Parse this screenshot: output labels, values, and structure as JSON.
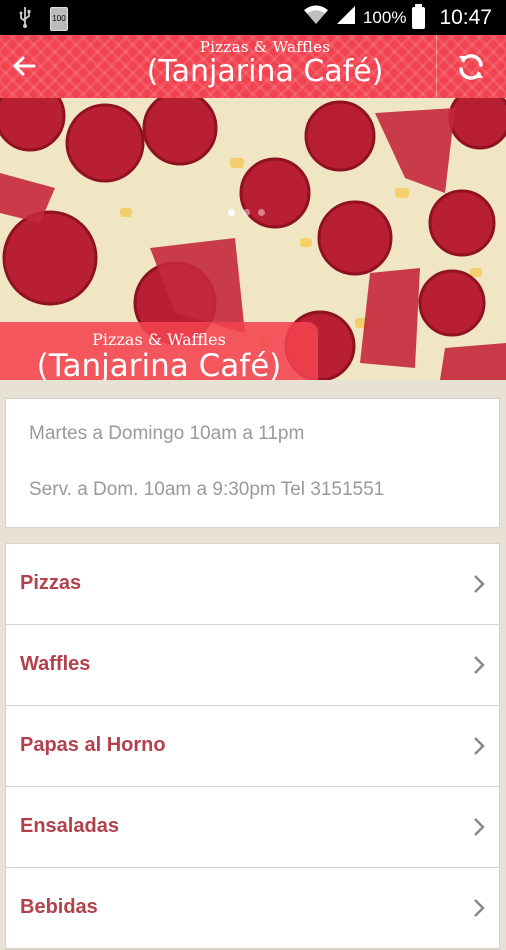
{
  "status_bar": {
    "battery_icon_label": "100",
    "battery_percent": "100%",
    "time": "10:47"
  },
  "header": {
    "subtitle": "Pizzas & Waffles",
    "title": "(Tanjarina Café)"
  },
  "hero": {
    "banner_subtitle": "Pizzas & Waffles",
    "banner_title": "(Tanjarina Café)",
    "carousel_pages": 3,
    "carousel_active": 1
  },
  "info": {
    "hours": "Martes a Domingo 10am a 11pm",
    "service": "Serv. a Dom. 10am a 9:30pm Tel 3151551"
  },
  "menu": {
    "items": [
      {
        "label": "Pizzas"
      },
      {
        "label": "Waffles"
      },
      {
        "label": "Papas al Horno"
      },
      {
        "label": "Ensaladas"
      },
      {
        "label": "Bebidas"
      }
    ]
  },
  "colors": {
    "accent": "#f2424f",
    "menu_text": "#b3414c",
    "background": "#e8e2d6"
  }
}
